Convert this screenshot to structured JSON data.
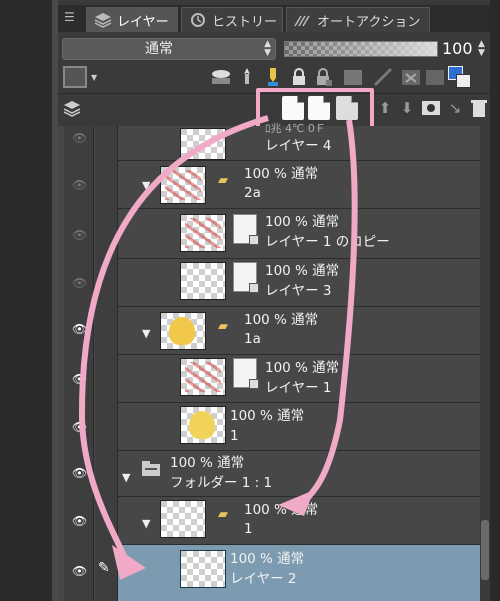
{
  "tabs": [
    {
      "label": "レイヤー",
      "icon": "layers-icon",
      "active": true
    },
    {
      "label": "ヒストリー",
      "icon": "history-icon",
      "active": false
    },
    {
      "label": "オートアクション",
      "icon": "auto-action-icon",
      "active": false
    }
  ],
  "blend_mode": "通常",
  "opacity": "100",
  "layer_toolbar": {
    "new_buttons": [
      "new-raster-layer-icon",
      "new-vector-layer-icon",
      "new-folder-icon"
    ]
  },
  "layers": [
    {
      "pct": "",
      "name": "レイヤー 4",
      "partial_top": "ﾛ兆 4℃ 0Ｆ"
    },
    {
      "pct": "100 % 通常",
      "name": "2a",
      "type": "folder"
    },
    {
      "pct": "100 % 通常",
      "name": "レイヤー 1 のコピー"
    },
    {
      "pct": "100 % 通常",
      "name": "レイヤー 3"
    },
    {
      "pct": "100 % 通常",
      "name": "1a",
      "type": "folder"
    },
    {
      "pct": "100 % 通常",
      "name": "レイヤー 1"
    },
    {
      "pct": "100 % 通常",
      "name": "1"
    },
    {
      "pct": "100 % 通常",
      "name": "フォルダー 1 : 1",
      "type": "folder"
    },
    {
      "pct": "100 % 通常",
      "name": "1",
      "type": "folder"
    },
    {
      "pct": "100 % 通常",
      "name": "レイヤー 2",
      "selected": true
    }
  ],
  "colors": {
    "highlight": "#f0a9c6",
    "selection": "#7c9bb0",
    "main_color": "#2e6fd3"
  }
}
